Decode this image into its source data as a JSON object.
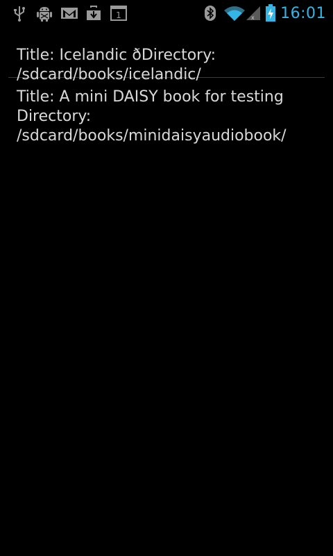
{
  "status_bar": {
    "time": "16:01",
    "accent_color": "#33b5e5",
    "left_icons": [
      "usb-icon",
      "android-debug-icon",
      "gmail-icon",
      "download-icon",
      "calendar-icon"
    ],
    "calendar_day": "1",
    "right_icons": [
      "bluetooth-icon",
      "wifi-icon",
      "cell-signal-icon",
      "battery-charging-icon"
    ]
  },
  "books": [
    {
      "text": "Title: Icelandic ðDirectory: /sdcard/books/icelandic/"
    },
    {
      "text": "Title: A mini DAISY book for testing Directory: /sdcard/books/minidaisyaudiobook/"
    }
  ]
}
